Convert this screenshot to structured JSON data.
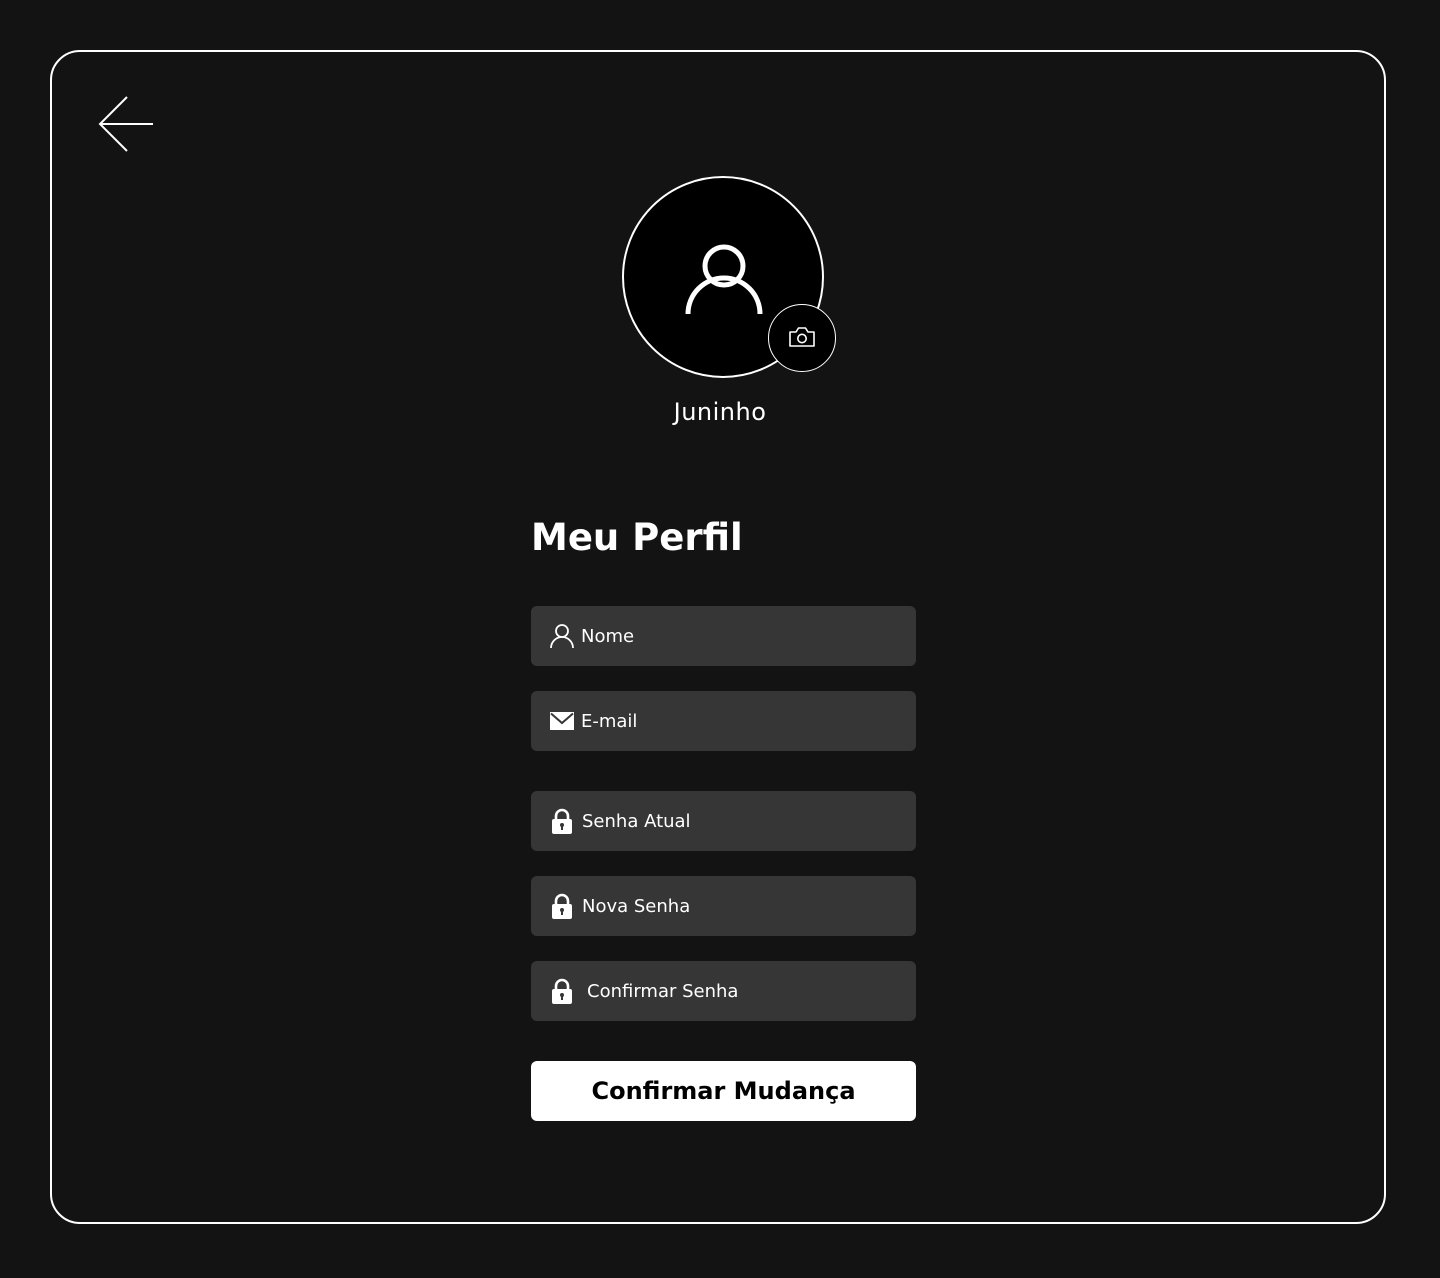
{
  "profile": {
    "username": "Juninho",
    "title": "Meu Perfil"
  },
  "form": {
    "fields": [
      {
        "placeholder": "Nome",
        "value": "",
        "icon": "user-icon"
      },
      {
        "placeholder": "E-mail",
        "value": "",
        "icon": "mail-icon"
      },
      {
        "placeholder": "Senha Atual",
        "value": "",
        "icon": "lock-icon"
      },
      {
        "placeholder": "Nova Senha",
        "value": "",
        "icon": "lock-icon"
      },
      {
        "placeholder": "Confirmar Senha",
        "value": "",
        "icon": "lock-icon"
      }
    ],
    "submit_label": "Confirmar Mudança"
  },
  "icons": {
    "back": "arrow-left-icon",
    "avatar": "user-icon",
    "camera": "camera-icon"
  },
  "colors": {
    "background": "#141314",
    "field_background": "#373637",
    "foreground": "#ffffff",
    "button_text": "#000000"
  }
}
